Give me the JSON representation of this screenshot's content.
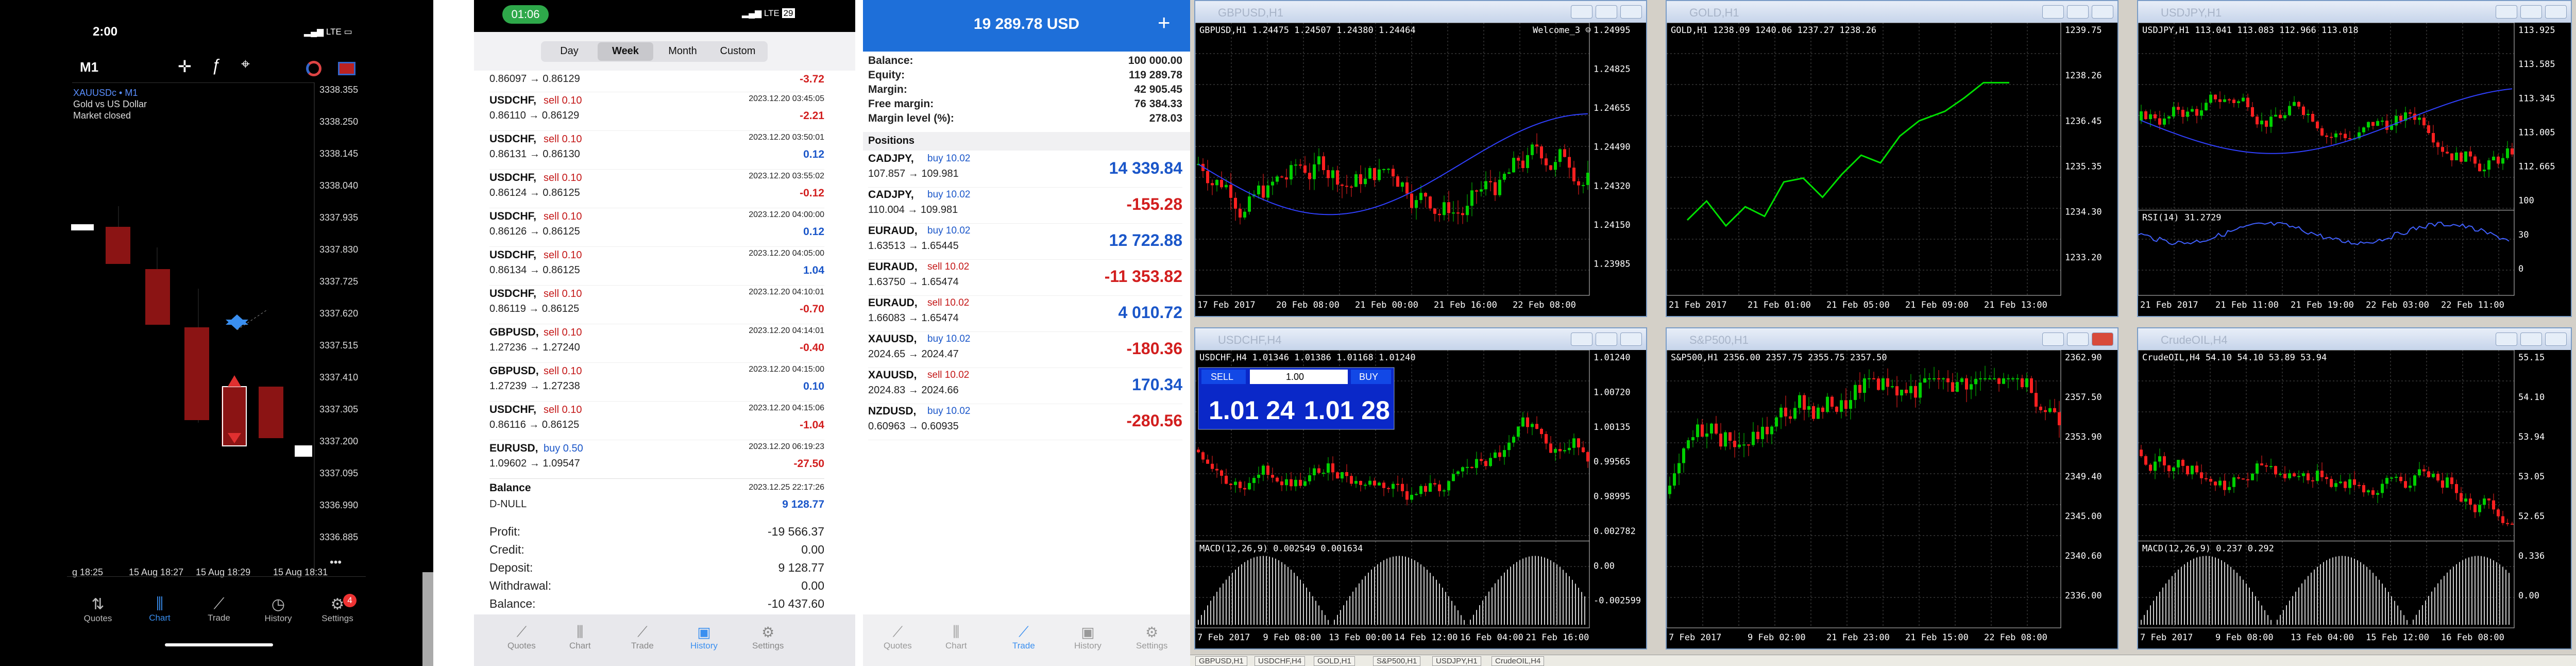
{
  "p1": {
    "status_time": "2:00",
    "status_net": "LTE",
    "timeframe": "M1",
    "symbol_line": "XAUUSDc • M1",
    "symbol_desc": "Gold vs US Dollar",
    "market_status": "Market closed",
    "price_ticks": [
      "3338.355",
      "3338.250",
      "3338.145",
      "3338.040",
      "3337.935",
      "3337.830",
      "3337.725",
      "3337.620",
      "3337.515",
      "3337.410",
      "3337.305",
      "3337.200",
      "3337.095",
      "3336.990",
      "3336.885"
    ],
    "time_ticks": [
      "g 18:25",
      "15 Aug 18:27",
      "15 Aug 18:29",
      "15 Aug 18:31"
    ],
    "more": "•••",
    "tabs": [
      "Quotes",
      "Chart",
      "Trade",
      "History",
      "Settings"
    ],
    "badge": "4"
  },
  "p2": {
    "status_time": "01:06",
    "status_net": "LTE",
    "battery": "29",
    "periods": [
      "Day",
      "Week",
      "Month",
      "Custom"
    ],
    "first_row": {
      "px": "0.86097 → 0.86129",
      "pl": "-3.72"
    },
    "rows": [
      {
        "sym": "USDCHF,",
        "dir": "sell 0.10",
        "dt": "2023.12.20 03:45:05",
        "px": "0.86110 → 0.86129",
        "pl": "-2.21"
      },
      {
        "sym": "USDCHF,",
        "dir": "sell 0.10",
        "dt": "2023.12.20 03:50:01",
        "px": "0.86131 → 0.86130",
        "pl": "0.12"
      },
      {
        "sym": "USDCHF,",
        "dir": "sell 0.10",
        "dt": "2023.12.20 03:55:02",
        "px": "0.86124 → 0.86125",
        "pl": "-0.12"
      },
      {
        "sym": "USDCHF,",
        "dir": "sell 0.10",
        "dt": "2023.12.20 04:00:00",
        "px": "0.86126 → 0.86125",
        "pl": "0.12"
      },
      {
        "sym": "USDCHF,",
        "dir": "sell 0.10",
        "dt": "2023.12.20 04:05:00",
        "px": "0.86134 → 0.86125",
        "pl": "1.04"
      },
      {
        "sym": "USDCHF,",
        "dir": "sell 0.10",
        "dt": "2023.12.20 04:10:01",
        "px": "0.86119 → 0.86125",
        "pl": "-0.70"
      },
      {
        "sym": "GBPUSD,",
        "dir": "sell 0.10",
        "dt": "2023.12.20 04:14:01",
        "px": "1.27236 → 1.27240",
        "pl": "-0.40"
      },
      {
        "sym": "GBPUSD,",
        "dir": "sell 0.10",
        "dt": "2023.12.20 04:15:00",
        "px": "1.27239 → 1.27238",
        "pl": "0.10"
      },
      {
        "sym": "USDCHF,",
        "dir": "sell 0.10",
        "dt": "2023.12.20 04:15:06",
        "px": "0.86116 → 0.86125",
        "pl": "-1.04"
      },
      {
        "sym": "EURUSD,",
        "dir": "buy 0.50",
        "dt": "2023.12.20 06:19:23",
        "px": "1.09602 → 1.09547",
        "pl": "-27.50"
      }
    ],
    "balance": {
      "label": "Balance",
      "dt": "2023.12.25 22:17:26",
      "name": "D-NULL",
      "value": "9 128.77"
    },
    "summary": [
      {
        "k": "Profit:",
        "v": "-19 566.37"
      },
      {
        "k": "Credit:",
        "v": "0.00"
      },
      {
        "k": "Deposit:",
        "v": "9 128.77"
      },
      {
        "k": "Withdrawal:",
        "v": "0.00"
      },
      {
        "k": "Balance:",
        "v": "-10 437.60"
      }
    ],
    "tabs": [
      "Quotes",
      "Chart",
      "Trade",
      "History",
      "Settings"
    ]
  },
  "p3": {
    "header": "19 289.78 USD",
    "plus": "+",
    "account": [
      {
        "k": "Balance:",
        "v": "100 000.00"
      },
      {
        "k": "Equity:",
        "v": "119 289.78"
      },
      {
        "k": "Margin:",
        "v": "42 905.45"
      },
      {
        "k": "Free margin:",
        "v": "76 384.33"
      },
      {
        "k": "Margin level (%):",
        "v": "278.03"
      }
    ],
    "positions_label": "Positions",
    "positions": [
      {
        "sym": "CADJPY,",
        "dir": "buy 10.02",
        "px": "107.857 → 109.981",
        "pl": "14 339.84"
      },
      {
        "sym": "CADJPY,",
        "dir": "buy 10.02",
        "px": "110.004 → 109.981",
        "pl": "-155.28"
      },
      {
        "sym": "EURAUD,",
        "dir": "buy 10.02",
        "px": "1.63513 → 1.65445",
        "pl": "12 722.88"
      },
      {
        "sym": "EURAUD,",
        "dir": "sell 10.02",
        "px": "1.63750 → 1.65474",
        "pl": "-11 353.82"
      },
      {
        "sym": "EURAUD,",
        "dir": "sell 10.02",
        "px": "1.66083 → 1.65474",
        "pl": "4 010.72"
      },
      {
        "sym": "XAUUSD,",
        "dir": "buy 10.02",
        "px": "2024.65 → 2024.47",
        "pl": "-180.36"
      },
      {
        "sym": "XAUUSD,",
        "dir": "sell 10.02",
        "px": "2024.83 → 2024.66",
        "pl": "170.34"
      },
      {
        "sym": "NZDUSD,",
        "dir": "buy 10.02",
        "px": "0.60963 → 0.60935",
        "pl": "-280.56"
      }
    ],
    "tabs": [
      "Quotes",
      "Chart",
      "Trade",
      "History",
      "Settings"
    ]
  },
  "p4": {
    "windows": [
      {
        "title": "GBPUSD,H1",
        "info": "GBPUSD,H1  1.24475 1.24507 1.24380 1.24464",
        "extra": "Welcome_3 ☺",
        "prices": [
          "1.24995",
          "1.24825",
          "1.24655",
          "1.24490",
          "1.24320",
          "1.24150",
          "1.23985"
        ],
        "times": [
          "17 Feb 2017",
          "20 Feb 08:00",
          "21 Feb 00:00",
          "21 Feb 16:00",
          "22 Feb 08:00"
        ]
      },
      {
        "title": "GOLD,H1",
        "info": "GOLD,H1  1238.09 1240.06 1237.27 1238.26",
        "extra": "",
        "prices": [
          "1239.75",
          "1238.26",
          "1236.45",
          "1235.35",
          "1234.30",
          "1233.20"
        ],
        "times": [
          "21 Feb 2017",
          "21 Feb 01:00",
          "21 Feb 05:00",
          "21 Feb 09:00",
          "21 Feb 13:00"
        ]
      },
      {
        "title": "USDJPY,H1",
        "info": "USDJPY,H1  113.041 113.083 112.966 113.018",
        "extra": "",
        "prices": [
          "113.925",
          "113.585",
          "113.345",
          "113.005",
          "112.665",
          "100",
          "30",
          "0"
        ],
        "times": [
          "21 Feb 2017",
          "21 Feb 11:00",
          "21 Feb 19:00",
          "22 Feb 03:00",
          "22 Feb 11:00"
        ],
        "sub": "RSI(14) 31.2729"
      },
      {
        "title": "USDCHF,H4",
        "info": "USDCHF,H4  1.01346 1.01386 1.01168 1.01240",
        "extra": "",
        "prices": [
          "1.01240",
          "1.00720",
          "1.00135",
          "0.99565",
          "0.98995",
          "0.002782",
          "0.00",
          "-0.002599"
        ],
        "times": [
          "7 Feb 2017",
          "9 Feb 08:00",
          "13 Feb 00:00",
          "14 Feb 12:00",
          "16 Feb 04:00",
          "21 Feb 16:00"
        ],
        "sub": "MACD(12,26,9) 0.002549 0.001634",
        "sell": "SELL",
        "buy": "BUY",
        "lot": "1.00",
        "sell_big": "1.01 24",
        "buy_big": "1.01 28",
        "sup": "0"
      },
      {
        "title": "S&P500,H1",
        "info": "S&P500,H1  2356.00 2357.75 2355.75 2357.50",
        "extra": "",
        "prices": [
          "2362.90",
          "2357.50",
          "2353.90",
          "2349.40",
          "2345.00",
          "2340.60",
          "2336.00"
        ],
        "times": [
          "7 Feb 2017",
          "9 Feb 02:00",
          "21 Feb 23:00",
          "21 Feb 15:00",
          "22 Feb 08:00"
        ]
      },
      {
        "title": "CrudeOIL,H4",
        "info": "CrudeOIL,H4  54.10 54.10 53.89 53.94",
        "extra": "",
        "prices": [
          "55.15",
          "54.10",
          "53.94",
          "53.05",
          "52.65",
          "0.336",
          "0.00"
        ],
        "times": [
          "7 Feb 2017",
          "9 Feb 08:00",
          "13 Feb 04:00",
          "15 Feb 12:00",
          "16 Feb 08:00"
        ],
        "sub": "MACD(12,26,9) 0.237 0.292"
      }
    ],
    "bottom_tabs": [
      "GBPUSD,H1",
      "USDCHF,H4",
      "GOLD,H1",
      "S&P500,H1",
      "USDJPY,H1",
      "CrudeOIL,H4"
    ]
  }
}
